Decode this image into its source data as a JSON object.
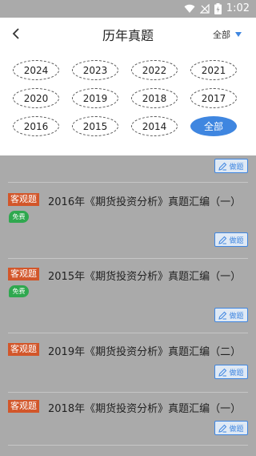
{
  "status_bar": {
    "time": "1:02"
  },
  "header": {
    "title": "历年真题",
    "filter_label": "全部"
  },
  "years": [
    "2024",
    "2023",
    "2022",
    "2021",
    "2020",
    "2019",
    "2018",
    "2017",
    "2016",
    "2015",
    "2014",
    "全部"
  ],
  "selected_year": "全部",
  "action_label": "做题",
  "questions": [
    {
      "tag": "客观题",
      "title": "2016年《期货投资分析》真题汇编（一）",
      "free_badge": "免费"
    },
    {
      "tag": "客观题",
      "title": "2015年《期货投资分析》真题汇编（一）",
      "free_badge": "免费"
    },
    {
      "tag": "客观题",
      "title": "2019年《期货投资分析》真题汇编（二）",
      "free_badge": ""
    },
    {
      "tag": "客观题",
      "title": "2018年《期货投资分析》真题汇编（一）",
      "free_badge": ""
    }
  ]
}
